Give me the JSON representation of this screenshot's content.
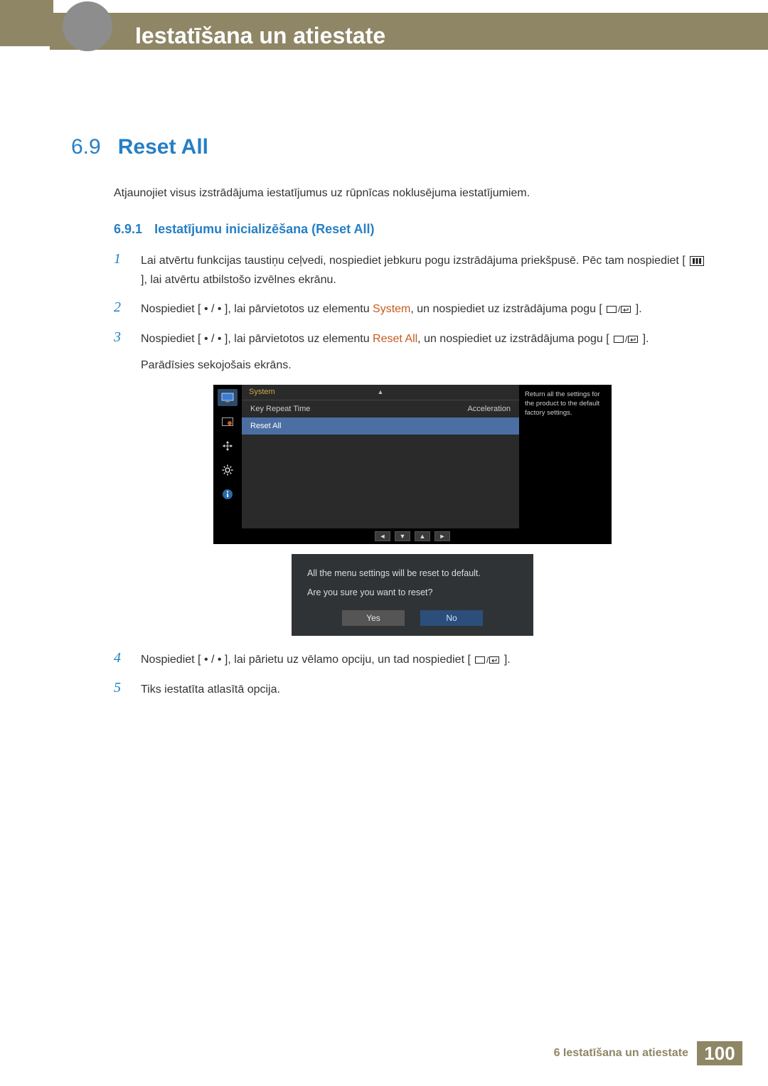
{
  "header": {
    "chapter_title": "Iestatīšana un atiestate"
  },
  "section": {
    "num": "6.9",
    "title": "Reset All"
  },
  "intro": "Atjaunojiet visus izstrādājuma iestatījumus uz rūpnīcas noklusējuma iestatījumiem.",
  "subsection": {
    "num": "6.9.1",
    "title": "Iestatījumu inicializēšana (Reset All)"
  },
  "steps": {
    "s1": {
      "n": "1",
      "a": "Lai atvērtu funkcijas taustiņu ceļvedi, nospiediet jebkuru pogu izstrādājuma priekšpusē. Pēc tam nospiediet [",
      "b": "], lai atvērtu atbilstošo izvēlnes ekrānu."
    },
    "s2": {
      "n": "2",
      "a": "Nospiediet [ • / • ], lai pārvietotos uz elementu ",
      "hl": "System",
      "b": ", un nospiediet uz izstrādājuma pogu [",
      "c": "]."
    },
    "s3": {
      "n": "3",
      "a": "Nospiediet [ • / • ], lai pārvietotos uz elementu ",
      "hl": "Reset All",
      "b": ", un nospiediet uz izstrādājuma pogu [",
      "c": "].",
      "tail": "Parādīsies sekojošais ekrāns."
    },
    "s4": {
      "n": "4",
      "a": "Nospiediet [ • / • ], lai pārietu uz vēlamo opciju, un tad nospiediet [",
      "b": "]."
    },
    "s5": {
      "n": "5",
      "a": "Tiks iestatīta atlasītā opcija."
    }
  },
  "osd": {
    "title": "System",
    "row1_label": "Key Repeat Time",
    "row1_value": "Acceleration",
    "row2_label": "Reset All",
    "help": "Return all the settings for the product to the default factory settings."
  },
  "dialog": {
    "line1": "All the menu settings will be reset to default.",
    "line2": "Are you sure you want to reset?",
    "yes": "Yes",
    "no": "No"
  },
  "footer": {
    "label": "6 Iestatīšana un atiestate",
    "page": "100"
  }
}
